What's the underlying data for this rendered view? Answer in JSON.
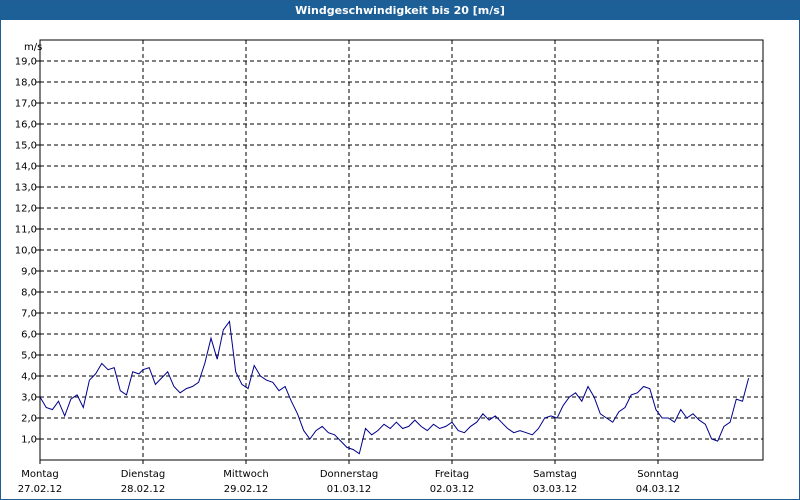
{
  "title": "Windgeschwindigkeit bis 20 [m/s]",
  "chart_data": {
    "type": "line",
    "title": "Windgeschwindigkeit bis 20 [m/s]",
    "ylabel": "m/s",
    "ylim": [
      0,
      20
    ],
    "y_ticks": [
      "1,0",
      "2,0",
      "3,0",
      "4,0",
      "5,0",
      "6,0",
      "7,0",
      "8,0",
      "9,0",
      "10,0",
      "11,0",
      "12,0",
      "13,0",
      "14,0",
      "15,0",
      "16,0",
      "17,0",
      "18,0",
      "19,0"
    ],
    "x_ticks": [
      {
        "day": "Montag",
        "date": "27.02.12"
      },
      {
        "day": "Dienstag",
        "date": "28.02.12"
      },
      {
        "day": "Mittwoch",
        "date": "29.02.12"
      },
      {
        "day": "Donnerstag",
        "date": "01.03.12"
      },
      {
        "day": "Freitag",
        "date": "02.03.12"
      },
      {
        "day": "Samstag",
        "date": "03.03.12"
      },
      {
        "day": "Sonntag",
        "date": "04.03.12"
      }
    ],
    "xlim_days": [
      0,
      6.9
    ],
    "grid": true,
    "line_color": "#00008b",
    "series": [
      {
        "x_days": [
          0.0,
          0.06,
          0.12,
          0.18,
          0.24,
          0.3,
          0.36,
          0.42,
          0.48,
          0.54,
          0.6,
          0.66,
          0.72,
          0.78,
          0.84,
          0.9,
          0.96,
          1.0,
          1.06,
          1.12,
          1.18,
          1.24,
          1.3,
          1.36,
          1.42,
          1.48,
          1.54,
          1.6,
          1.66,
          1.72,
          1.78,
          1.84,
          1.9,
          1.96,
          2.02,
          2.08,
          2.14,
          2.2,
          2.26,
          2.32,
          2.38,
          2.44,
          2.5,
          2.56,
          2.62,
          2.68,
          2.74,
          2.8,
          2.86,
          2.92,
          2.98,
          3.04,
          3.1,
          3.16,
          3.22,
          3.28,
          3.34,
          3.4,
          3.46,
          3.52,
          3.58,
          3.64,
          3.7,
          3.76,
          3.82,
          3.88,
          3.94,
          4.0,
          4.06,
          4.12,
          4.18,
          4.24,
          4.3,
          4.36,
          4.42,
          4.48,
          4.54,
          4.6,
          4.66,
          4.72,
          4.78,
          4.84,
          4.9,
          4.96,
          5.02,
          5.08,
          5.14,
          5.2,
          5.26,
          5.32,
          5.38,
          5.44,
          5.5,
          5.56,
          5.62,
          5.68,
          5.74,
          5.8,
          5.86,
          5.92,
          5.98,
          6.04,
          6.1,
          6.16,
          6.22,
          6.28,
          6.34,
          6.4,
          6.46,
          6.52,
          6.58,
          6.64,
          6.7,
          6.76,
          6.82,
          6.88
        ],
        "y": [
          3.0,
          2.5,
          2.4,
          2.8,
          2.1,
          2.9,
          3.1,
          2.5,
          3.8,
          4.1,
          4.6,
          4.3,
          4.4,
          3.3,
          3.1,
          4.2,
          4.1,
          4.3,
          4.4,
          3.6,
          3.9,
          4.2,
          3.5,
          3.2,
          3.4,
          3.5,
          3.7,
          4.6,
          5.8,
          4.8,
          6.2,
          6.6,
          4.2,
          3.6,
          3.4,
          4.5,
          4.0,
          3.8,
          3.7,
          3.3,
          3.5,
          2.8,
          2.2,
          1.4,
          1.0,
          1.4,
          1.6,
          1.3,
          1.2,
          0.9,
          0.6,
          0.5,
          0.3,
          1.5,
          1.2,
          1.4,
          1.7,
          1.5,
          1.8,
          1.5,
          1.6,
          1.9,
          1.6,
          1.4,
          1.7,
          1.5,
          1.6,
          1.8,
          1.4,
          1.3,
          1.6,
          1.8,
          2.2,
          1.9,
          2.1,
          1.8,
          1.5,
          1.3,
          1.4,
          1.3,
          1.2,
          1.5,
          2.0,
          2.1,
          2.0,
          2.6,
          3.0,
          3.2,
          2.8,
          3.5,
          3.0,
          2.2,
          2.0,
          1.8,
          2.3,
          2.5,
          3.1,
          3.2,
          3.5,
          3.4,
          2.4,
          2.0,
          2.0,
          1.8,
          2.4,
          2.0,
          2.2,
          1.9,
          1.7,
          1.0,
          0.9,
          1.6,
          1.8,
          2.9,
          2.8,
          3.9
        ]
      }
    ]
  }
}
